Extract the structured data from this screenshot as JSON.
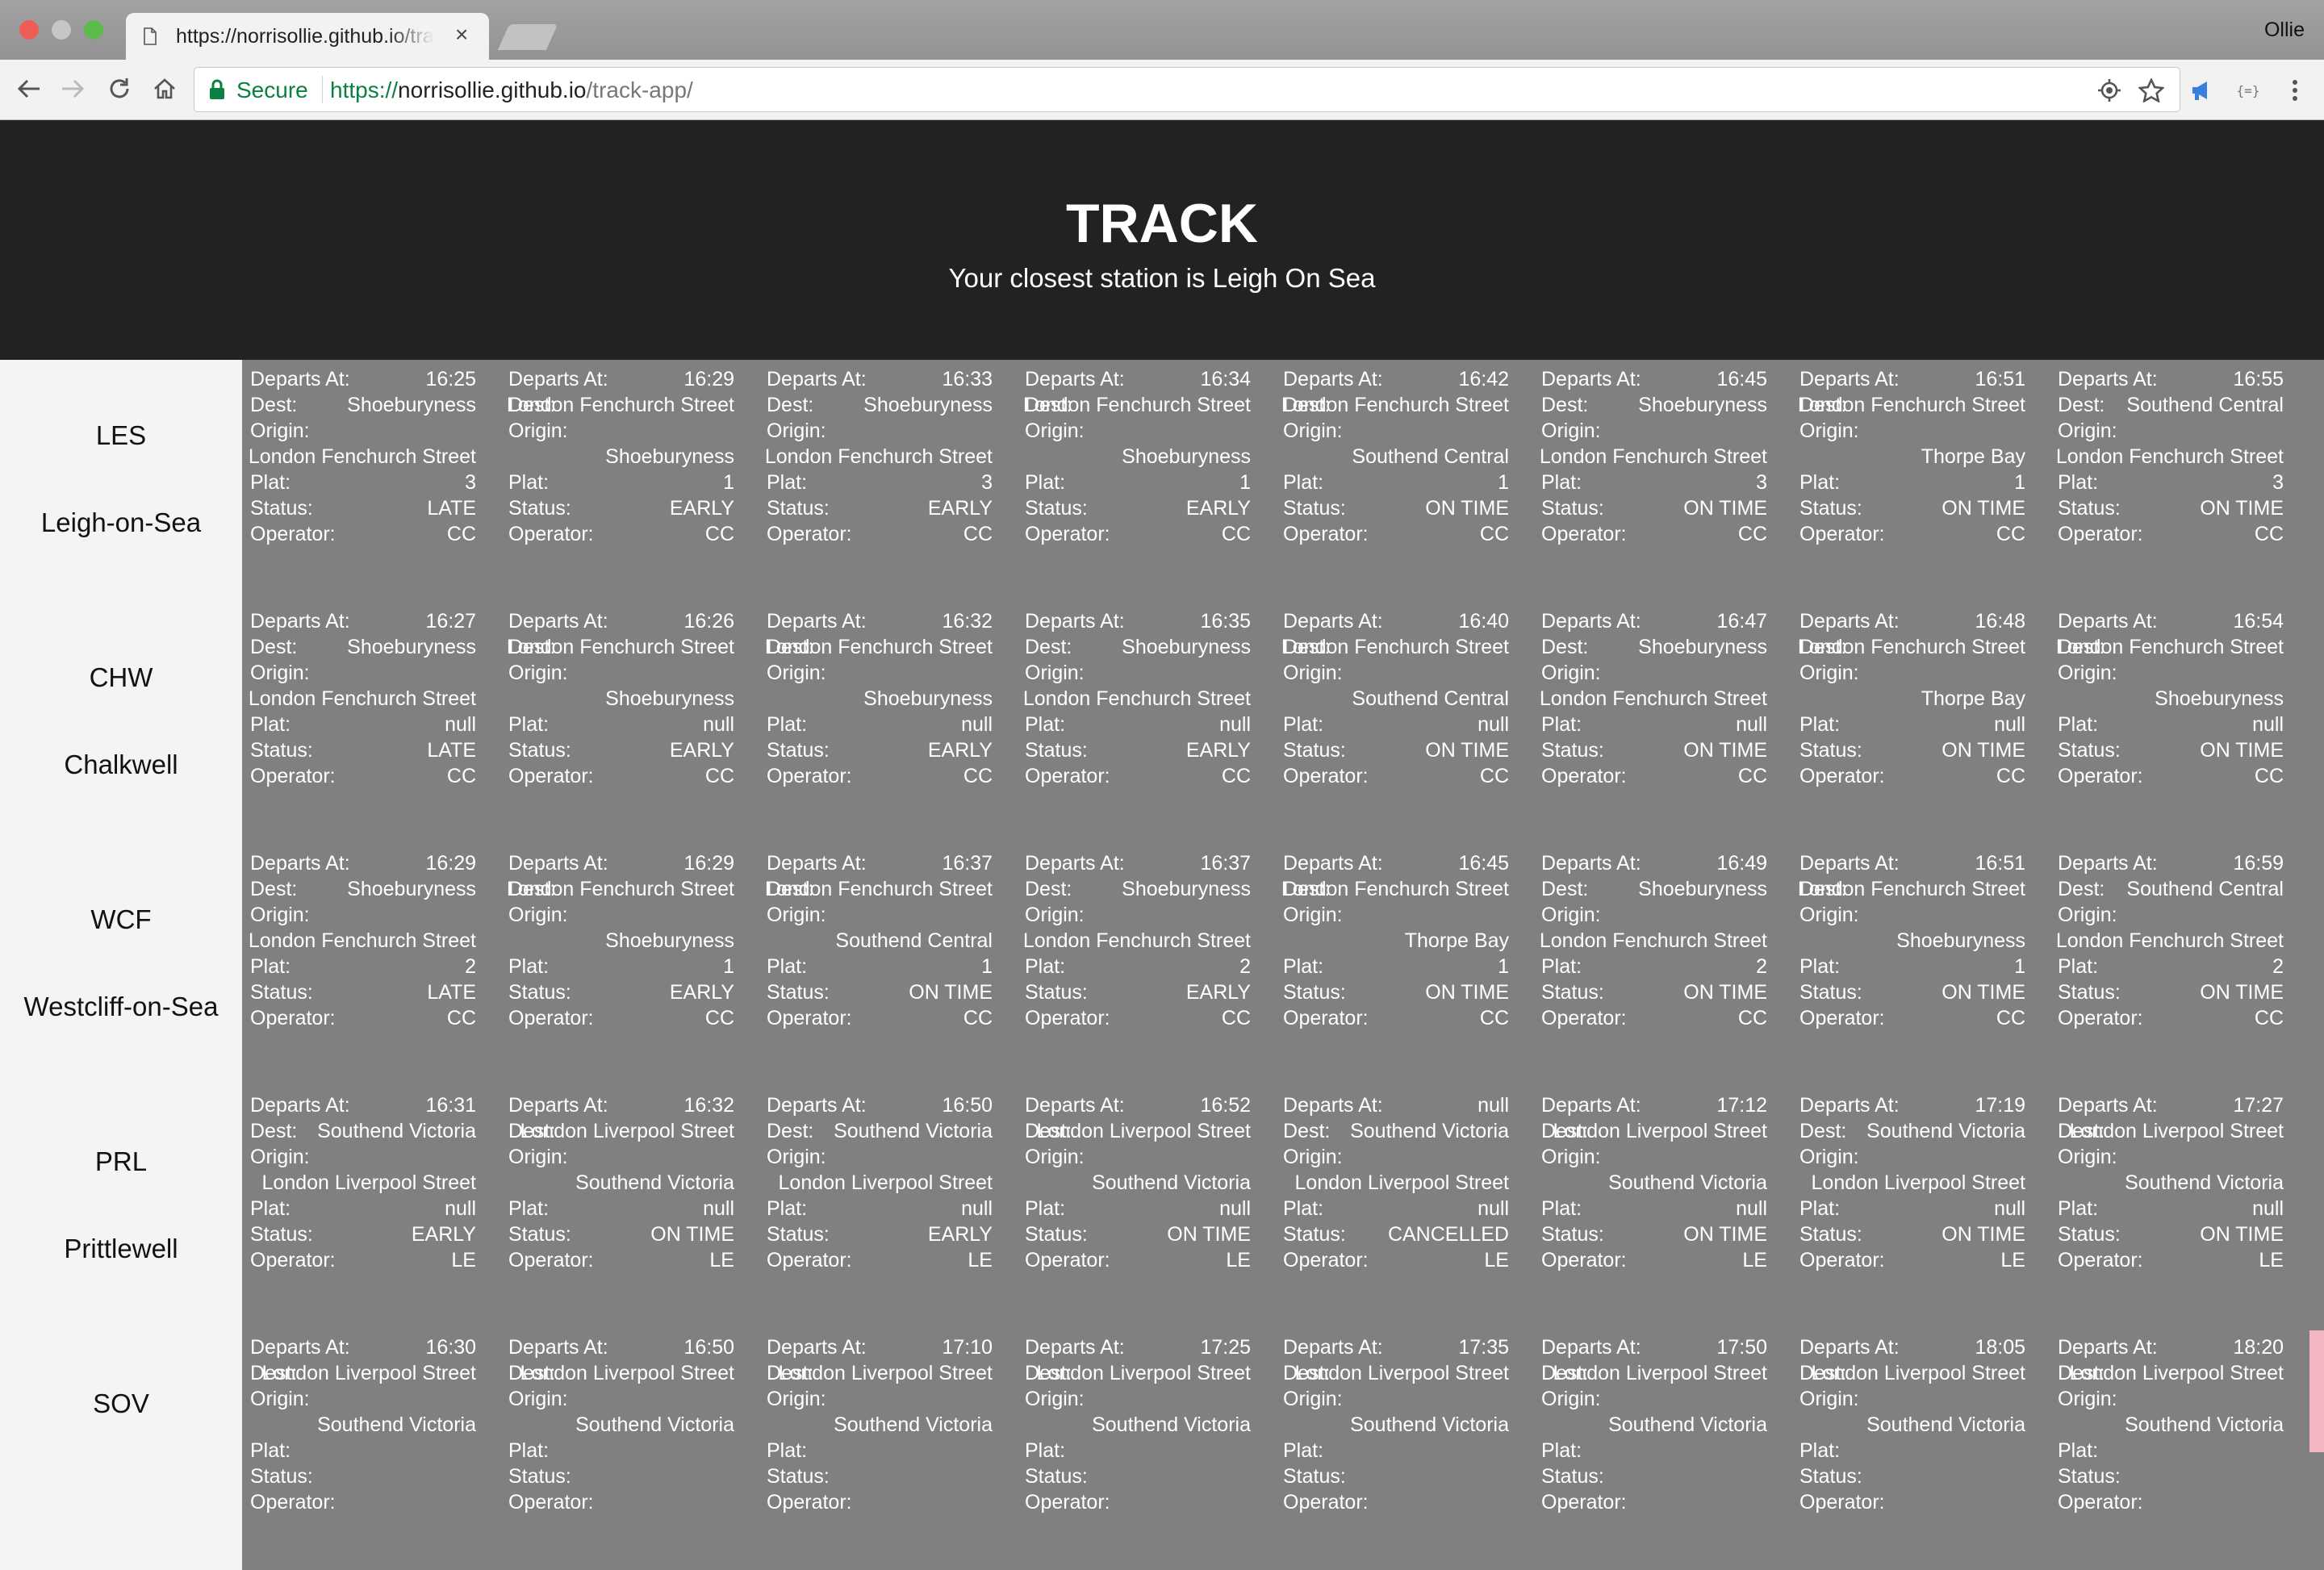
{
  "browser": {
    "tab_title": "https://norrisollie.github.io/track-app/",
    "close_glyph": "×",
    "profile_name": "Ollie",
    "secure_label": "Secure",
    "url_scheme": "https://",
    "url_host": "norrisollie.github.io",
    "url_path": "/track-app/",
    "icons": [
      "back-arrow-icon",
      "forward-arrow-icon",
      "reload-icon",
      "home-icon",
      "lock-icon",
      "location-icon",
      "star-icon",
      "extension-megaphone-icon",
      "json-extension-icon",
      "menu-dots-icon"
    ]
  },
  "header": {
    "title": "TRACK",
    "subtitle": "Your closest station is Leigh On Sea"
  },
  "labels": {
    "departs": "Departs At:",
    "dest": "Dest:",
    "origin": "Origin:",
    "plat": "Plat:",
    "status": "Status:",
    "operator": "Operator:"
  },
  "stations": [
    {
      "code": "LES",
      "name": "Leigh-on-Sea",
      "departures": [
        {
          "time": "16:25",
          "dest": "Shoeburyness",
          "origin": "London Fenchurch Street",
          "plat": "3",
          "status": "LATE",
          "operator": "CC"
        },
        {
          "time": "16:29",
          "dest": "London Fenchurch Street",
          "origin": "Shoeburyness",
          "plat": "1",
          "status": "EARLY",
          "operator": "CC"
        },
        {
          "time": "16:33",
          "dest": "Shoeburyness",
          "origin": "London Fenchurch Street",
          "plat": "3",
          "status": "EARLY",
          "operator": "CC"
        },
        {
          "time": "16:34",
          "dest": "London Fenchurch Street",
          "origin": "Shoeburyness",
          "plat": "1",
          "status": "EARLY",
          "operator": "CC"
        },
        {
          "time": "16:42",
          "dest": "London Fenchurch Street",
          "origin": "Southend Central",
          "plat": "1",
          "status": "ON TIME",
          "operator": "CC"
        },
        {
          "time": "16:45",
          "dest": "Shoeburyness",
          "origin": "London Fenchurch Street",
          "plat": "3",
          "status": "ON TIME",
          "operator": "CC"
        },
        {
          "time": "16:51",
          "dest": "London Fenchurch Street",
          "origin": "Thorpe Bay",
          "plat": "1",
          "status": "ON TIME",
          "operator": "CC"
        },
        {
          "time": "16:55",
          "dest": "Southend Central",
          "origin": "London Fenchurch Street",
          "plat": "3",
          "status": "ON TIME",
          "operator": "CC"
        }
      ]
    },
    {
      "code": "CHW",
      "name": "Chalkwell",
      "departures": [
        {
          "time": "16:27",
          "dest": "Shoeburyness",
          "origin": "London Fenchurch Street",
          "plat": "null",
          "status": "LATE",
          "operator": "CC"
        },
        {
          "time": "16:26",
          "dest": "London Fenchurch Street",
          "origin": "Shoeburyness",
          "plat": "null",
          "status": "EARLY",
          "operator": "CC"
        },
        {
          "time": "16:32",
          "dest": "London Fenchurch Street",
          "origin": "Shoeburyness",
          "plat": "null",
          "status": "EARLY",
          "operator": "CC"
        },
        {
          "time": "16:35",
          "dest": "Shoeburyness",
          "origin": "London Fenchurch Street",
          "plat": "null",
          "status": "EARLY",
          "operator": "CC"
        },
        {
          "time": "16:40",
          "dest": "London Fenchurch Street",
          "origin": "Southend Central",
          "plat": "null",
          "status": "ON TIME",
          "operator": "CC"
        },
        {
          "time": "16:47",
          "dest": "Shoeburyness",
          "origin": "London Fenchurch Street",
          "plat": "null",
          "status": "ON TIME",
          "operator": "CC"
        },
        {
          "time": "16:48",
          "dest": "London Fenchurch Street",
          "origin": "Thorpe Bay",
          "plat": "null",
          "status": "ON TIME",
          "operator": "CC"
        },
        {
          "time": "16:54",
          "dest": "London Fenchurch Street",
          "origin": "Shoeburyness",
          "plat": "null",
          "status": "ON TIME",
          "operator": "CC"
        }
      ]
    },
    {
      "code": "WCF",
      "name": "Westcliff-on-Sea",
      "departures": [
        {
          "time": "16:29",
          "dest": "Shoeburyness",
          "origin": "London Fenchurch Street",
          "plat": "2",
          "status": "LATE",
          "operator": "CC"
        },
        {
          "time": "16:29",
          "dest": "London Fenchurch Street",
          "origin": "Shoeburyness",
          "plat": "1",
          "status": "EARLY",
          "operator": "CC"
        },
        {
          "time": "16:37",
          "dest": "London Fenchurch Street",
          "origin": "Southend Central",
          "plat": "1",
          "status": "ON TIME",
          "operator": "CC"
        },
        {
          "time": "16:37",
          "dest": "Shoeburyness",
          "origin": "London Fenchurch Street",
          "plat": "2",
          "status": "EARLY",
          "operator": "CC"
        },
        {
          "time": "16:45",
          "dest": "London Fenchurch Street",
          "origin": "Thorpe Bay",
          "plat": "1",
          "status": "ON TIME",
          "operator": "CC"
        },
        {
          "time": "16:49",
          "dest": "Shoeburyness",
          "origin": "London Fenchurch Street",
          "plat": "2",
          "status": "ON TIME",
          "operator": "CC"
        },
        {
          "time": "16:51",
          "dest": "London Fenchurch Street",
          "origin": "Shoeburyness",
          "plat": "1",
          "status": "ON TIME",
          "operator": "CC"
        },
        {
          "time": "16:59",
          "dest": "Southend Central",
          "origin": "London Fenchurch Street",
          "plat": "2",
          "status": "ON TIME",
          "operator": "CC"
        }
      ]
    },
    {
      "code": "PRL",
      "name": "Prittlewell",
      "departures": [
        {
          "time": "16:31",
          "dest": "Southend Victoria",
          "origin": "London Liverpool Street",
          "plat": "null",
          "status": "EARLY",
          "operator": "LE"
        },
        {
          "time": "16:32",
          "dest": "London Liverpool Street",
          "origin": "Southend Victoria",
          "plat": "null",
          "status": "ON TIME",
          "operator": "LE"
        },
        {
          "time": "16:50",
          "dest": "Southend Victoria",
          "origin": "London Liverpool Street",
          "plat": "null",
          "status": "EARLY",
          "operator": "LE"
        },
        {
          "time": "16:52",
          "dest": "London Liverpool Street",
          "origin": "Southend Victoria",
          "plat": "null",
          "status": "ON TIME",
          "operator": "LE"
        },
        {
          "time": "null",
          "dest": "Southend Victoria",
          "origin": "London Liverpool Street",
          "plat": "null",
          "status": "CANCELLED",
          "operator": "LE"
        },
        {
          "time": "17:12",
          "dest": "London Liverpool Street",
          "origin": "Southend Victoria",
          "plat": "null",
          "status": "ON TIME",
          "operator": "LE"
        },
        {
          "time": "17:19",
          "dest": "Southend Victoria",
          "origin": "London Liverpool Street",
          "plat": "null",
          "status": "ON TIME",
          "operator": "LE"
        },
        {
          "time": "17:27",
          "dest": "London Liverpool Street",
          "origin": "Southend Victoria",
          "plat": "null",
          "status": "ON TIME",
          "operator": "LE"
        }
      ]
    },
    {
      "code": "SOV",
      "name": "",
      "departures": [
        {
          "time": "16:30",
          "dest": "London Liverpool Street",
          "origin": "Southend Victoria",
          "plat": "",
          "status": "",
          "operator": ""
        },
        {
          "time": "16:50",
          "dest": "London Liverpool Street",
          "origin": "Southend Victoria",
          "plat": "",
          "status": "",
          "operator": ""
        },
        {
          "time": "17:10",
          "dest": "London Liverpool Street",
          "origin": "Southend Victoria",
          "plat": "",
          "status": "",
          "operator": ""
        },
        {
          "time": "17:25",
          "dest": "London Liverpool Street",
          "origin": "Southend Victoria",
          "plat": "",
          "status": "",
          "operator": ""
        },
        {
          "time": "17:35",
          "dest": "London Liverpool Street",
          "origin": "Southend Victoria",
          "plat": "",
          "status": "",
          "operator": ""
        },
        {
          "time": "17:50",
          "dest": "London Liverpool Street",
          "origin": "Southend Victoria",
          "plat": "",
          "status": "",
          "operator": ""
        },
        {
          "time": "18:05",
          "dest": "London Liverpool Street",
          "origin": "Southend Victoria",
          "plat": "",
          "status": "",
          "operator": ""
        },
        {
          "time": "18:20",
          "dest": "London Liverpool Street",
          "origin": "Southend Victoria",
          "plat": "",
          "status": "",
          "operator": ""
        }
      ]
    }
  ],
  "colors": {
    "header_bg": "#222222",
    "departures_bg": "#808080",
    "station_bg": "#f4f4f4",
    "secure_green": "#0b8043",
    "scroll_thumb": "#f4b6c3"
  }
}
